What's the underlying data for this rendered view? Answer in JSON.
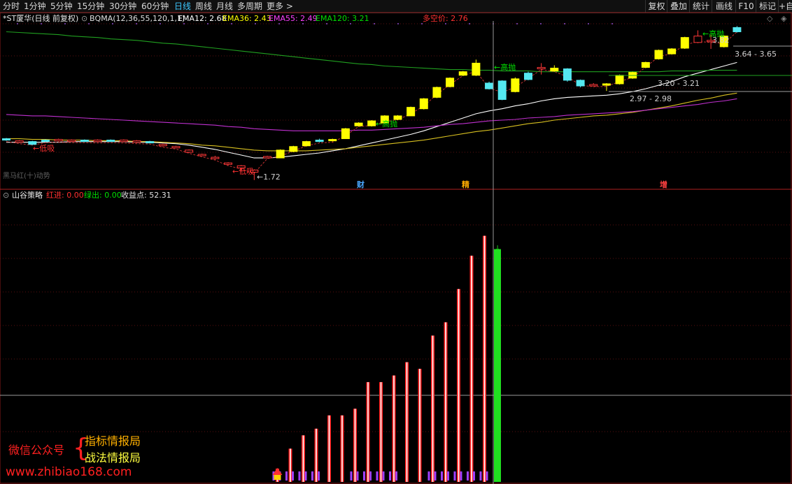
{
  "toolbar": {
    "left": [
      {
        "label": "分时"
      },
      {
        "label": "1分钟"
      },
      {
        "label": "5分钟"
      },
      {
        "label": "15分钟"
      },
      {
        "label": "30分钟"
      },
      {
        "label": "60分钟"
      },
      {
        "label": "日线",
        "active": true
      },
      {
        "label": "周线"
      },
      {
        "label": "月线"
      },
      {
        "label": "多周期"
      },
      {
        "label": "更多 >"
      }
    ],
    "right": [
      {
        "label": "复权"
      },
      {
        "label": "叠加"
      },
      {
        "label": "统计"
      },
      {
        "label": "画线"
      },
      {
        "label": "F10"
      },
      {
        "label": "标记"
      },
      {
        "label": "+自"
      }
    ]
  },
  "main_panel": {
    "title": "*ST厦华(日线 前复权)",
    "indicator": "BQMA(12,36,55,120,1,1)",
    "ema": [
      {
        "label": "EMA12: 2.68",
        "color": "#ffffff"
      },
      {
        "label": "EMA36: 2.43",
        "color": "#ffff00"
      },
      {
        "label": "EMA55: 2.49",
        "color": "#ff40ff"
      },
      {
        "label": "EMA120: 3.21",
        "color": "#00e000"
      }
    ],
    "multi_short": "多空价: 2.76",
    "annotations": {
      "low_suck_1": "←低吸",
      "low_suck_2": "←低吸",
      "low_price": "←1.72",
      "high_throw_1": "←高抛",
      "high_throw_2": "←高抛",
      "high_throw_3": "←高抛",
      "price_382": "3.82",
      "range_364": "3.64 - 3.65",
      "range_320": "3.20 - 3.21",
      "range_297": "2.97 - 2.98",
      "bottom_left": "黑马红(十)动势"
    },
    "markers": [
      {
        "text": "财",
        "color": "#4aa8ff"
      },
      {
        "text": "精",
        "color": "#ffaa00"
      },
      {
        "text": "增",
        "color": "#ff4040"
      }
    ]
  },
  "sub_panel": {
    "title": "山谷策略",
    "red_in": "红进: 0.00",
    "green_out": "绿出: 0.00",
    "profit": "收益点: 52.31"
  },
  "watermark": {
    "wechat": "微信公众号",
    "line1": "指标情报局",
    "line2": "战法情报局",
    "site": "www.zhibiao168.com"
  },
  "chart_data": [
    {
      "type": "candlestick",
      "title": "*ST厦华(日线 前复权)",
      "candles": [
        {
          "o": 2.28,
          "c": 2.3,
          "h": 2.31,
          "l": 2.27,
          "up": false
        },
        {
          "o": 2.27,
          "c": 2.25,
          "h": 2.28,
          "l": 2.24,
          "up": false
        },
        {
          "o": 2.22,
          "c": 2.26,
          "h": 2.27,
          "l": 2.21,
          "up": true
        },
        {
          "o": 2.27,
          "c": 2.28,
          "h": 2.29,
          "l": 2.26,
          "up": true
        },
        {
          "o": 2.29,
          "c": 2.27,
          "h": 2.3,
          "l": 2.26,
          "up": false
        },
        {
          "o": 2.28,
          "c": 2.27,
          "h": 2.29,
          "l": 2.26,
          "up": false
        },
        {
          "o": 2.27,
          "c": 2.28,
          "h": 2.29,
          "l": 2.26,
          "up": true
        },
        {
          "o": 2.28,
          "c": 2.26,
          "h": 2.29,
          "l": 2.25,
          "up": false
        },
        {
          "o": 2.27,
          "c": 2.28,
          "h": 2.29,
          "l": 2.26,
          "up": true
        },
        {
          "o": 2.28,
          "c": 2.26,
          "h": 2.29,
          "l": 2.25,
          "up": false
        },
        {
          "o": 2.27,
          "c": 2.25,
          "h": 2.28,
          "l": 2.24,
          "up": false
        },
        {
          "o": 2.25,
          "c": 2.26,
          "h": 2.27,
          "l": 2.24,
          "up": true
        },
        {
          "o": 2.22,
          "c": 2.2,
          "h": 2.23,
          "l": 2.19,
          "up": false
        },
        {
          "o": 2.19,
          "c": 2.18,
          "h": 2.2,
          "l": 2.17,
          "up": false
        },
        {
          "o": 2.14,
          "c": 2.11,
          "h": 2.15,
          "l": 2.1,
          "up": false
        },
        {
          "o": 2.08,
          "c": 2.07,
          "h": 2.09,
          "l": 2.06,
          "up": false
        },
        {
          "o": 2.04,
          "c": 2.02,
          "h": 2.06,
          "l": 2.0,
          "up": false
        },
        {
          "o": 1.96,
          "c": 1.94,
          "h": 1.97,
          "l": 1.92,
          "up": false
        },
        {
          "o": 1.92,
          "c": 1.89,
          "h": 1.93,
          "l": 1.84,
          "up": false
        },
        {
          "o": 1.86,
          "c": 1.83,
          "h": 1.87,
          "l": 1.72,
          "up": false
        },
        {
          "o": 2.05,
          "c": 2.05,
          "h": 2.06,
          "l": 2.04,
          "up": true
        },
        {
          "o": 2.03,
          "c": 2.14,
          "h": 2.15,
          "l": 2.03,
          "up": true
        },
        {
          "o": 2.12,
          "c": 2.19,
          "h": 2.2,
          "l": 2.11,
          "up": true
        },
        {
          "o": 2.2,
          "c": 2.26,
          "h": 2.27,
          "l": 2.19,
          "up": true
        },
        {
          "o": 2.28,
          "c": 2.26,
          "h": 2.3,
          "l": 2.25,
          "up": true
        },
        {
          "o": 2.27,
          "c": 2.29,
          "h": 2.3,
          "l": 2.26,
          "up": true
        },
        {
          "o": 2.3,
          "c": 2.44,
          "h": 2.45,
          "l": 2.3,
          "up": true
        },
        {
          "o": 2.48,
          "c": 2.52,
          "h": 2.53,
          "l": 2.47,
          "up": true
        },
        {
          "o": 2.48,
          "c": 2.55,
          "h": 2.56,
          "l": 2.47,
          "up": true
        },
        {
          "o": 2.52,
          "c": 2.62,
          "h": 2.63,
          "l": 2.51,
          "up": true
        },
        {
          "o": 2.57,
          "c": 2.62,
          "h": 2.63,
          "l": 2.56,
          "up": true
        },
        {
          "o": 2.62,
          "c": 2.74,
          "h": 2.75,
          "l": 2.62,
          "up": true
        },
        {
          "o": 2.72,
          "c": 2.86,
          "h": 2.87,
          "l": 2.71,
          "up": true
        },
        {
          "o": 2.88,
          "c": 3.02,
          "h": 3.03,
          "l": 2.87,
          "up": true
        },
        {
          "o": 3.03,
          "c": 3.15,
          "h": 3.16,
          "l": 3.02,
          "up": true
        },
        {
          "o": 3.19,
          "c": 3.24,
          "h": 3.25,
          "l": 3.18,
          "up": true
        },
        {
          "o": 3.19,
          "c": 3.36,
          "h": 3.41,
          "l": 3.18,
          "up": true
        },
        {
          "o": 3.08,
          "c": 3.0,
          "h": 3.1,
          "l": 2.99,
          "up": false
        },
        {
          "o": 3.11,
          "c": 2.85,
          "h": 3.12,
          "l": 2.84,
          "up": true
        },
        {
          "o": 2.96,
          "c": 3.14,
          "h": 3.16,
          "l": 2.95,
          "up": true
        },
        {
          "o": 3.22,
          "c": 3.13,
          "h": 3.24,
          "l": 3.12,
          "up": true
        },
        {
          "o": 3.3,
          "c": 3.3,
          "h": 3.36,
          "l": 3.2,
          "up": true
        },
        {
          "o": 3.25,
          "c": 3.29,
          "h": 3.33,
          "l": 3.24,
          "up": true
        },
        {
          "o": 3.28,
          "c": 3.12,
          "h": 3.29,
          "l": 3.1,
          "up": true
        },
        {
          "o": 3.12,
          "c": 3.04,
          "h": 3.13,
          "l": 3.02,
          "up": false
        },
        {
          "o": 3.06,
          "c": 3.06,
          "h": 3.08,
          "l": 3.05,
          "up": true
        },
        {
          "o": 3.06,
          "c": 3.07,
          "h": 3.08,
          "l": 2.97,
          "up": true
        },
        {
          "o": 3.07,
          "c": 3.19,
          "h": 3.2,
          "l": 3.06,
          "up": true
        },
        {
          "o": 3.15,
          "c": 3.23,
          "h": 3.24,
          "l": 3.14,
          "up": true
        },
        {
          "o": 3.3,
          "c": 3.37,
          "h": 3.38,
          "l": 3.29,
          "up": true
        },
        {
          "o": 3.42,
          "c": 3.54,
          "h": 3.55,
          "l": 3.41,
          "up": true
        },
        {
          "o": 3.49,
          "c": 3.56,
          "h": 3.57,
          "l": 3.48,
          "up": true
        },
        {
          "o": 3.57,
          "c": 3.72,
          "h": 3.73,
          "l": 3.56,
          "up": true
        },
        {
          "o": 3.65,
          "c": 3.74,
          "h": 3.82,
          "l": 3.64,
          "up": true
        },
        {
          "o": 3.68,
          "c": 3.68,
          "h": 3.76,
          "l": 3.56,
          "up": true
        },
        {
          "o": 3.59,
          "c": 3.74,
          "h": 3.75,
          "l": 3.58,
          "up": true
        },
        {
          "o": 3.86,
          "c": 3.8,
          "h": 3.88,
          "l": 3.79,
          "up": false
        }
      ],
      "ylim": [
        1.6,
        4.05
      ],
      "series": [
        {
          "name": "EMA12",
          "values": [
            2.25,
            2.25,
            2.25,
            2.25,
            2.25,
            2.26,
            2.26,
            2.26,
            2.26,
            2.26,
            2.25,
            2.25,
            2.24,
            2.23,
            2.21,
            2.18,
            2.15,
            2.11,
            2.07,
            2.03,
            2.03,
            2.04,
            2.06,
            2.08,
            2.1,
            2.13,
            2.16,
            2.2,
            2.24,
            2.28,
            2.32,
            2.36,
            2.41,
            2.47,
            2.53,
            2.59,
            2.65,
            2.69,
            2.72,
            2.76,
            2.79,
            2.83,
            2.86,
            2.88,
            2.89,
            2.9,
            2.91,
            2.93,
            2.96,
            3.0,
            3.05,
            3.1,
            3.17,
            3.22,
            3.27,
            3.32,
            3.37
          ]
        },
        {
          "name": "EMA36",
          "values": [
            2.3,
            2.3,
            2.29,
            2.29,
            2.28,
            2.28,
            2.28,
            2.27,
            2.27,
            2.27,
            2.26,
            2.26,
            2.25,
            2.24,
            2.23,
            2.21,
            2.2,
            2.18,
            2.16,
            2.14,
            2.13,
            2.13,
            2.13,
            2.13,
            2.14,
            2.15,
            2.16,
            2.18,
            2.2,
            2.22,
            2.24,
            2.26,
            2.28,
            2.31,
            2.34,
            2.37,
            2.4,
            2.42,
            2.45,
            2.48,
            2.51,
            2.53,
            2.56,
            2.58,
            2.6,
            2.62,
            2.63,
            2.65,
            2.67,
            2.7,
            2.73,
            2.76,
            2.8,
            2.84,
            2.87,
            2.91,
            2.94
          ]
        },
        {
          "name": "EMA55",
          "values": [
            2.64,
            2.63,
            2.62,
            2.62,
            2.61,
            2.6,
            2.59,
            2.58,
            2.57,
            2.56,
            2.55,
            2.54,
            2.53,
            2.52,
            2.51,
            2.5,
            2.49,
            2.47,
            2.46,
            2.44,
            2.43,
            2.42,
            2.41,
            2.41,
            2.41,
            2.41,
            2.41,
            2.42,
            2.42,
            2.43,
            2.44,
            2.45,
            2.46,
            2.48,
            2.5,
            2.51,
            2.53,
            2.55,
            2.56,
            2.57,
            2.59,
            2.6,
            2.61,
            2.63,
            2.64,
            2.65,
            2.66,
            2.67,
            2.68,
            2.7,
            2.72,
            2.74,
            2.76,
            2.78,
            2.81,
            2.83,
            2.86
          ]
        },
        {
          "name": "EMA120",
          "values": [
            3.8,
            3.79,
            3.78,
            3.77,
            3.76,
            3.74,
            3.73,
            3.72,
            3.7,
            3.69,
            3.68,
            3.66,
            3.64,
            3.63,
            3.61,
            3.59,
            3.57,
            3.55,
            3.53,
            3.51,
            3.49,
            3.47,
            3.45,
            3.43,
            3.41,
            3.39,
            3.37,
            3.35,
            3.34,
            3.32,
            3.31,
            3.3,
            3.29,
            3.28,
            3.27,
            3.27,
            3.26,
            3.26,
            3.25,
            3.25,
            3.25,
            3.24,
            3.24,
            3.24,
            3.24,
            3.24,
            3.24,
            3.24,
            3.24,
            3.24,
            3.24,
            3.25,
            3.25,
            3.25,
            3.26,
            3.26,
            3.26
          ]
        }
      ]
    },
    {
      "type": "bar",
      "title": "山谷策略",
      "series": [
        {
          "name": "红进",
          "values": [
            0,
            0,
            0,
            0,
            0,
            0,
            0,
            0,
            0,
            0,
            0,
            0,
            0,
            0,
            0,
            0,
            0,
            0,
            0,
            0,
            0,
            2,
            5,
            7,
            8,
            10,
            10,
            11,
            15,
            15,
            16,
            18,
            17,
            22,
            24,
            29,
            34,
            37,
            39
          ]
        },
        {
          "name": "绿出",
          "values": [
            0,
            0,
            0,
            0,
            0,
            0,
            0,
            0,
            0,
            0,
            0,
            0,
            0,
            0,
            0,
            0,
            0,
            0,
            0,
            0,
            0,
            0,
            0,
            0,
            0,
            0,
            0,
            0,
            0,
            0,
            0,
            0,
            0,
            0,
            0,
            0,
            0,
            0,
            35
          ]
        }
      ],
      "ylim": [
        0,
        42
      ]
    }
  ]
}
